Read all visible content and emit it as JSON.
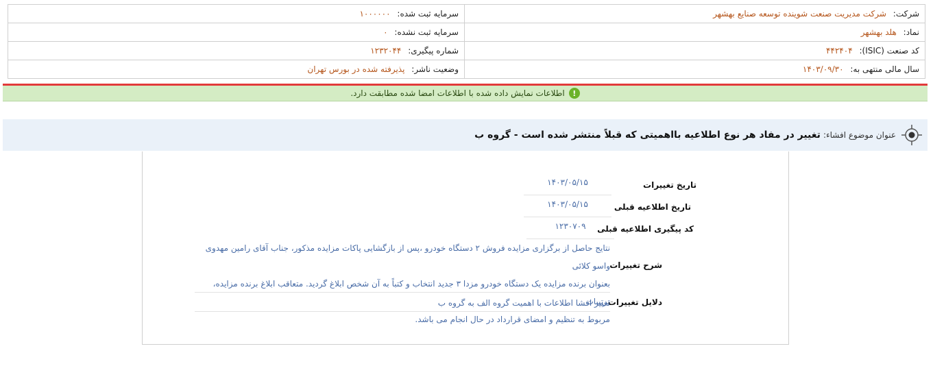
{
  "info": {
    "company_label": "شرکت:",
    "company_value": "شرکت مدیریت صنعت شوینده توسعه صنایع بهشهر",
    "reg_capital_label": "سرمایه ثبت شده:",
    "reg_capital_value": "۱۰۰۰۰۰۰",
    "symbol_label": "نماد:",
    "symbol_value": "هلد بهشهر",
    "unreg_capital_label": "سرمایه ثبت نشده:",
    "unreg_capital_value": "۰",
    "isic_label": "کد صنعت (ISIC):",
    "isic_value": "۴۴۲۴۰۴",
    "tracking_label": "شماره پیگیری:",
    "tracking_value": "۱۲۳۲۰۴۴",
    "fiscal_label": "سال مالی منتهی به:",
    "fiscal_value": "۱۴۰۳/۰۹/۳۰",
    "status_label": "وضعیت ناشر:",
    "status_value": "پذیرفته شده در بورس تهران"
  },
  "notice": {
    "text": "اطلاعات نمایش داده شده با اطلاعات امضا شده مطابقت دارد.",
    "icon": "!"
  },
  "subject": {
    "label": "عنوان موضوع افشاء:",
    "value": "تغییر در مفاد هر نوع اطلاعیه بااهمیتی که قبلاً منتشر شده است - گروه ب"
  },
  "details": {
    "change_date_label": "تاریخ تغییرات",
    "change_date_value": "۱۴۰۳/۰۵/۱۵",
    "prev_date_label": "تاریخ اطلاعیه قبلی",
    "prev_date_value": "۱۴۰۳/۰۵/۱۵",
    "prev_tracking_label": "کد پیگیری اطلاعیه قبلی",
    "prev_tracking_value": "۱۲۳۰۷۰۹",
    "desc_label": "شرح تغییرات",
    "desc_line1": "نتایج حاصل از برگزاری مزایده فروش ۲ دستگاه خودرو ،پس از بازگشایی پاکات مزایده مذکور، جناب آقای رامین مهدوی واسو کلائی",
    "desc_line2": "بعنوان برنده مزایده یک دستگاه خودرو مزدا ۳ جدید انتخاب و کتباً به آن شخص ابلاغ گردید. متعاقب ابلاغ برنده مزایده، ترتیبات",
    "desc_line3": "مربوط به تنظیم و امضای قرارداد در حال انجام می باشد.",
    "reason_label": "دلایل تغییرات",
    "reason_value": "تغییر افشا اطلاعات با اهمیت گروه الف به گروه ب"
  }
}
